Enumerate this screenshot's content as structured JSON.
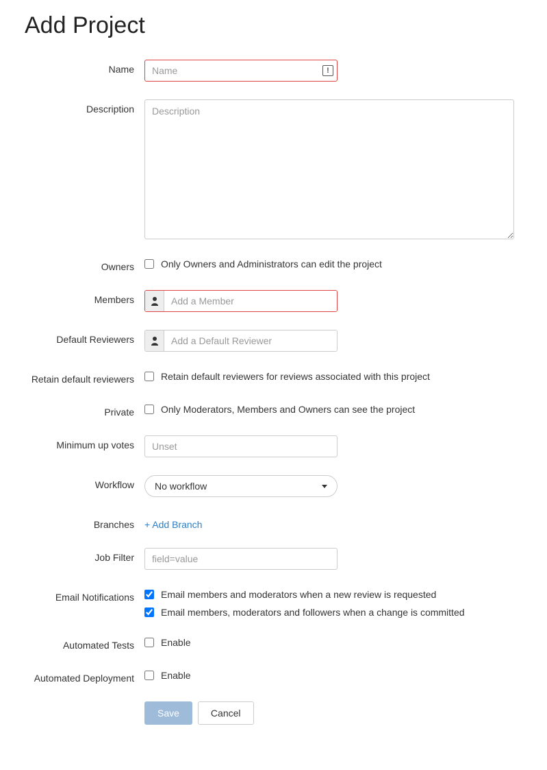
{
  "title": "Add Project",
  "labels": {
    "name": "Name",
    "description": "Description",
    "owners": "Owners",
    "members": "Members",
    "default_reviewers": "Default Reviewers",
    "retain_default_reviewers": "Retain default reviewers",
    "private": "Private",
    "min_up_votes": "Minimum up votes",
    "workflow": "Workflow",
    "branches": "Branches",
    "job_filter": "Job Filter",
    "email_notifications": "Email Notifications",
    "automated_tests": "Automated Tests",
    "automated_deployment": "Automated Deployment"
  },
  "placeholders": {
    "name": "Name",
    "description": "Description",
    "member": "Add a Member",
    "default_reviewer": "Add a Default Reviewer",
    "min_up_votes": "Unset",
    "job_filter": "field=value"
  },
  "values": {
    "name": "",
    "description": "",
    "owners_only_edit": false,
    "retain_default_reviewers": false,
    "private": false,
    "min_up_votes": "",
    "workflow_selected": "No workflow",
    "job_filter": "",
    "email_new_review": true,
    "email_change_committed": true,
    "automated_tests_enable": false,
    "automated_deployment_enable": false
  },
  "text": {
    "owners_checkbox": "Only Owners and Administrators can edit the project",
    "retain_checkbox": "Retain default reviewers for reviews associated with this project",
    "private_checkbox": "Only Moderators, Members and Owners can see the project",
    "add_branch": "+ Add Branch",
    "email_new_review": "Email members and moderators when a new review is requested",
    "email_change_committed": "Email members, moderators and followers when a change is committed",
    "enable": "Enable",
    "warn": "!"
  },
  "buttons": {
    "save": "Save",
    "cancel": "Cancel"
  }
}
